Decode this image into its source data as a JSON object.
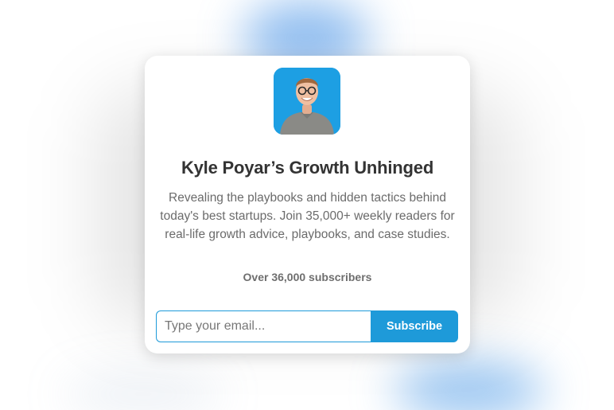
{
  "publication": {
    "title": "Kyle Poyar’s Growth Unhinged",
    "description": "Revealing the playbooks and hidden tactics behind today's best startups. Join 35,000+ weekly readers for real-life growth advice, playbooks, and case studies.",
    "subscriber_count": "Over 36,000 subscribers",
    "avatar_icon": "author-photo"
  },
  "subscribe_form": {
    "email_placeholder": "Type your email...",
    "email_value": "",
    "button_label": "Subscribe"
  },
  "colors": {
    "accent": "#1e9ad9",
    "avatar_background": "#1d9fe3",
    "title_text": "#333333",
    "body_text": "#6b6b6b"
  }
}
